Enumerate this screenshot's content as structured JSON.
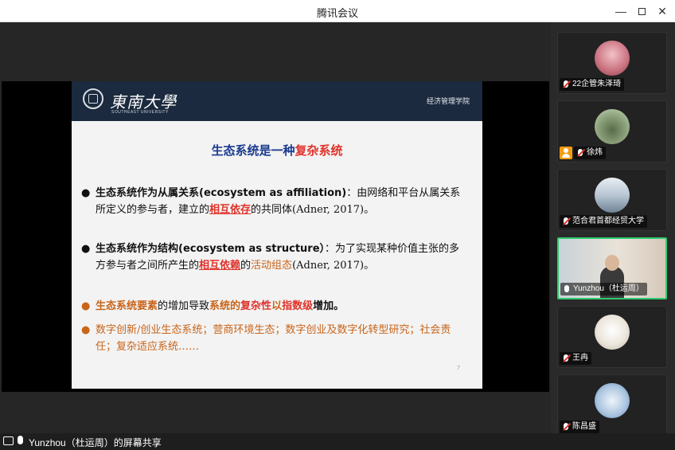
{
  "window": {
    "title": "腾讯会议"
  },
  "slide": {
    "university_name": "東南大學",
    "university_sub": "SOUTHEAST UNIVERSITY",
    "school": "经济管理学院",
    "title_prefix": "生态系统是一种",
    "title_highlight": "复杂系统",
    "bullet1": {
      "bold": "生态系统作为从属关系",
      "en": "(ecosystem as affiliation)",
      "text1": "：由网络和平台从属关系所定义的参与者，建立的",
      "highlight": "相互依存",
      "text2": "的共同体(Adner, 2017)。"
    },
    "bullet2": {
      "bold": "生态系统作为结构",
      "en": "(ecosystem as structure）",
      "text1": "：为了实现某种价值主张的多方参与者之间所产生的",
      "highlight": "相互依赖",
      "text2": "的",
      "orange": "活动组态",
      "text3": "(Adner, 2017)。"
    },
    "bullet3": {
      "part1": "生态系统要素",
      "part2": "的增加导致",
      "part3": "系统的",
      "part4": "复杂性",
      "part5": "以",
      "part6": "指数级",
      "part7": "增加。"
    },
    "bullet4": {
      "text": "数字创新/创业生态系统；营商环境生态；数字创业及数字化转型研究；社会责任；复杂适应系统……"
    },
    "page_number": "7"
  },
  "share_bar": {
    "text": "Yunzhou（杜运周）的屏幕共享"
  },
  "participants": [
    {
      "name": "22企管朱泽琦",
      "mic": "muted",
      "avatar": "avatar-photo"
    },
    {
      "name": "徐炜",
      "mic": "muted",
      "avatar": "avatar-photo"
    },
    {
      "name": "范合君首都经贸大学",
      "mic": "muted",
      "avatar": "avatar-photo"
    },
    {
      "name": "Yunzhou（杜运周）",
      "mic": "on",
      "avatar": "video"
    },
    {
      "name": "王冉",
      "mic": "muted",
      "avatar": "avatar-photo"
    },
    {
      "name": "陈昌盛",
      "mic": "muted",
      "avatar": "avatar-photo"
    }
  ],
  "colors": {
    "accent_green": "#2ecc71",
    "slide_red": "#e0322a",
    "slide_blue": "#1a3a8f",
    "slide_orange": "#c8651a"
  }
}
